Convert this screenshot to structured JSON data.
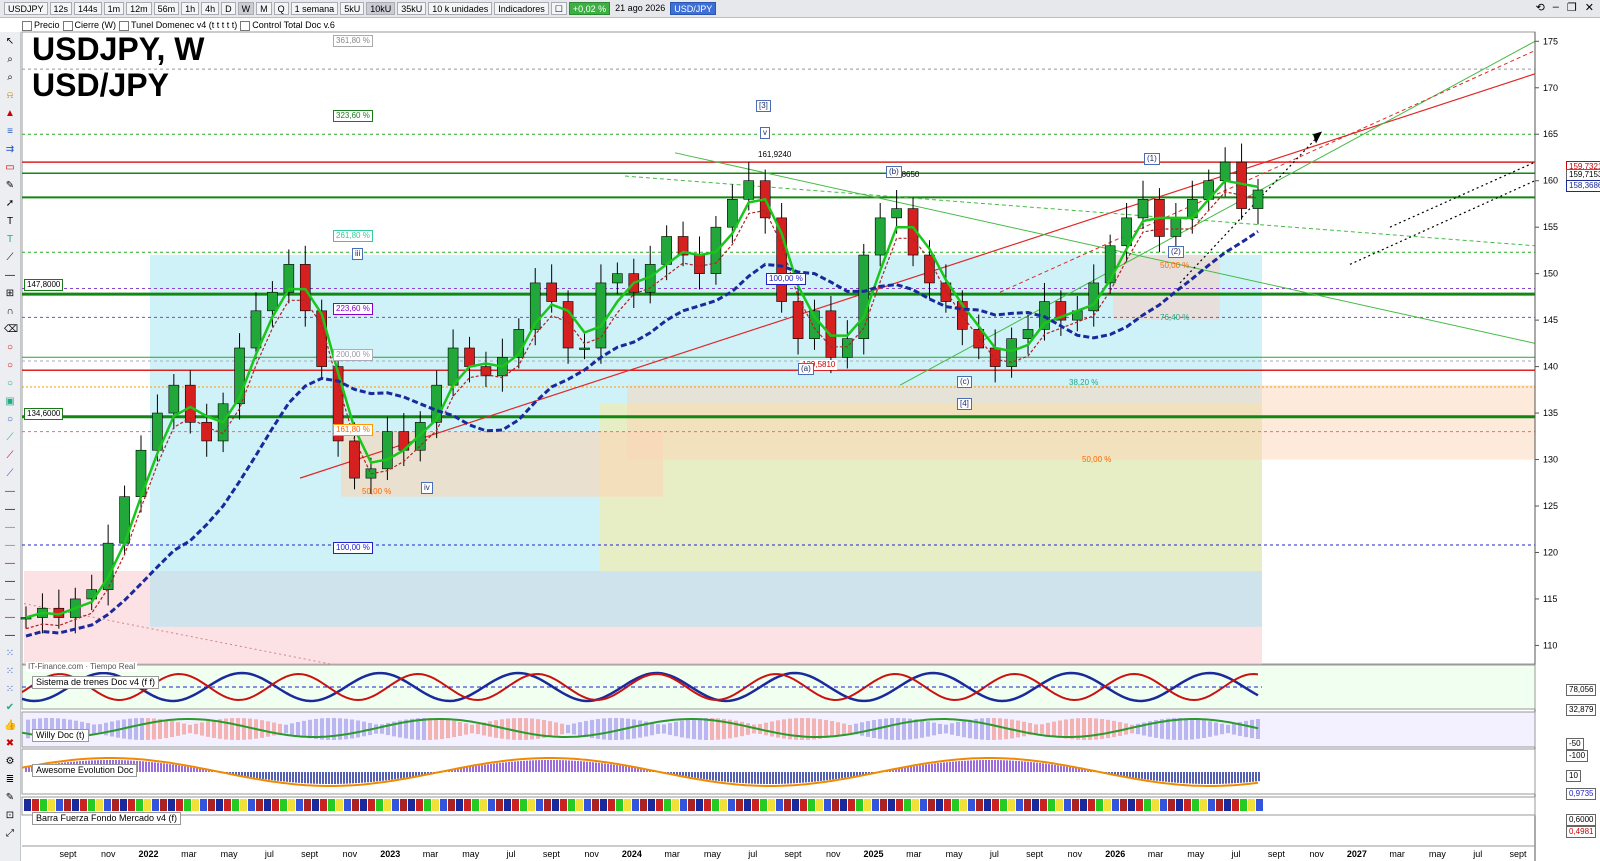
{
  "toolbar": {
    "symbol": "USDJPY",
    "intervals": [
      "12s",
      "144s",
      "1m",
      "12m",
      "56m",
      "1h",
      "4h",
      "D",
      "W",
      "M",
      "Q"
    ],
    "active_interval": "W",
    "period": "1 semana",
    "tick_buttons": [
      "5kU",
      "10kU",
      "35kU"
    ],
    "units": "10 k unidades",
    "indicators": "Indicadores",
    "change": "+0,02 %",
    "date": "21 ago 2026",
    "symbol_badge": "USD/JPY"
  },
  "legend_bar": {
    "items": [
      "Precio",
      "Cierre (W)",
      "Tunel Domenec v4 (t t t t t)",
      "Control Total Doc v.6"
    ]
  },
  "chart": {
    "title_line1": "USDJPY, W",
    "title_line2": "USD/JPY",
    "y_ticks": [
      "175",
      "170",
      "165",
      "160",
      "155",
      "150",
      "145",
      "140",
      "135",
      "130",
      "125",
      "120",
      "115",
      "110"
    ],
    "x_ticks": [
      "sept",
      "nov",
      "2022",
      "mar",
      "may",
      "jul",
      "sept",
      "nov",
      "2023",
      "mar",
      "may",
      "jul",
      "sept",
      "nov",
      "2024",
      "mar",
      "may",
      "jul",
      "sept",
      "nov",
      "2025",
      "mar",
      "may",
      "jul",
      "sept",
      "nov",
      "2026",
      "mar",
      "may",
      "jul",
      "sept",
      "nov",
      "2027",
      "mar",
      "may",
      "jul",
      "sept"
    ],
    "price_tags": [
      "159,7321",
      "159,7153",
      "158,3686"
    ],
    "left_levels": [
      "147,8000",
      "134,6000"
    ],
    "fib_labels": [
      "361,80 %",
      "323,60 %",
      "261,80 %",
      "223,60 %",
      "200,00 %",
      "161,80 %",
      "100,00 %",
      "50,00 %",
      "100,00 %",
      "38,20 %",
      "50,00 %",
      "76,40 %",
      "50,00 %"
    ],
    "price_marks": [
      "161,9240",
      "158,8650",
      "139,5810"
    ],
    "wave_labels": [
      "[3]",
      "v",
      "iii",
      "iv",
      "(a)",
      "(b)",
      "(c)",
      "[4]",
      "(1)",
      "(2)"
    ],
    "footer_note": "IT-Finance.com · Tiempo Real"
  },
  "indicators": [
    {
      "name": "Sistema de trenes Doc v4 (f f)",
      "values": [
        "78,056",
        "32,879"
      ]
    },
    {
      "name": "Willy Doc (t)",
      "values": [
        "-50",
        "-100"
      ]
    },
    {
      "name": "Awesome Evolution Doc",
      "values": [
        "10",
        "0,9735"
      ]
    },
    {
      "name": "Barra Fuerza Fondo Mercado v4 (f)",
      "values": [
        "0,6000",
        "0,4981"
      ]
    }
  ],
  "colors": {
    "bull": "#22a83a",
    "bear": "#d62020",
    "ma_green": "#1ac61a",
    "ma_red": "#b22222",
    "ma_blue": "#1a2a9a",
    "ma_brown": "#8b5a2b"
  },
  "chart_data": {
    "type": "candlestick",
    "title": "USDJPY, W",
    "ylim": [
      108,
      176
    ],
    "close_series": [
      113,
      114,
      113,
      115,
      116,
      121,
      126,
      131,
      135,
      138,
      134,
      132,
      136,
      142,
      146,
      148,
      151,
      146,
      140,
      132,
      128,
      129,
      133,
      131,
      134,
      138,
      142,
      140,
      139,
      141,
      144,
      149,
      147,
      142,
      142,
      149,
      150,
      148,
      151,
      154,
      152,
      150,
      155,
      158,
      160,
      156,
      147,
      143,
      146,
      141,
      143,
      152,
      156,
      157,
      152,
      149,
      147,
      144,
      142,
      140,
      143,
      144,
      147,
      145,
      146,
      149,
      153,
      156,
      158,
      154,
      156,
      158,
      160,
      162,
      157,
      159
    ]
  }
}
